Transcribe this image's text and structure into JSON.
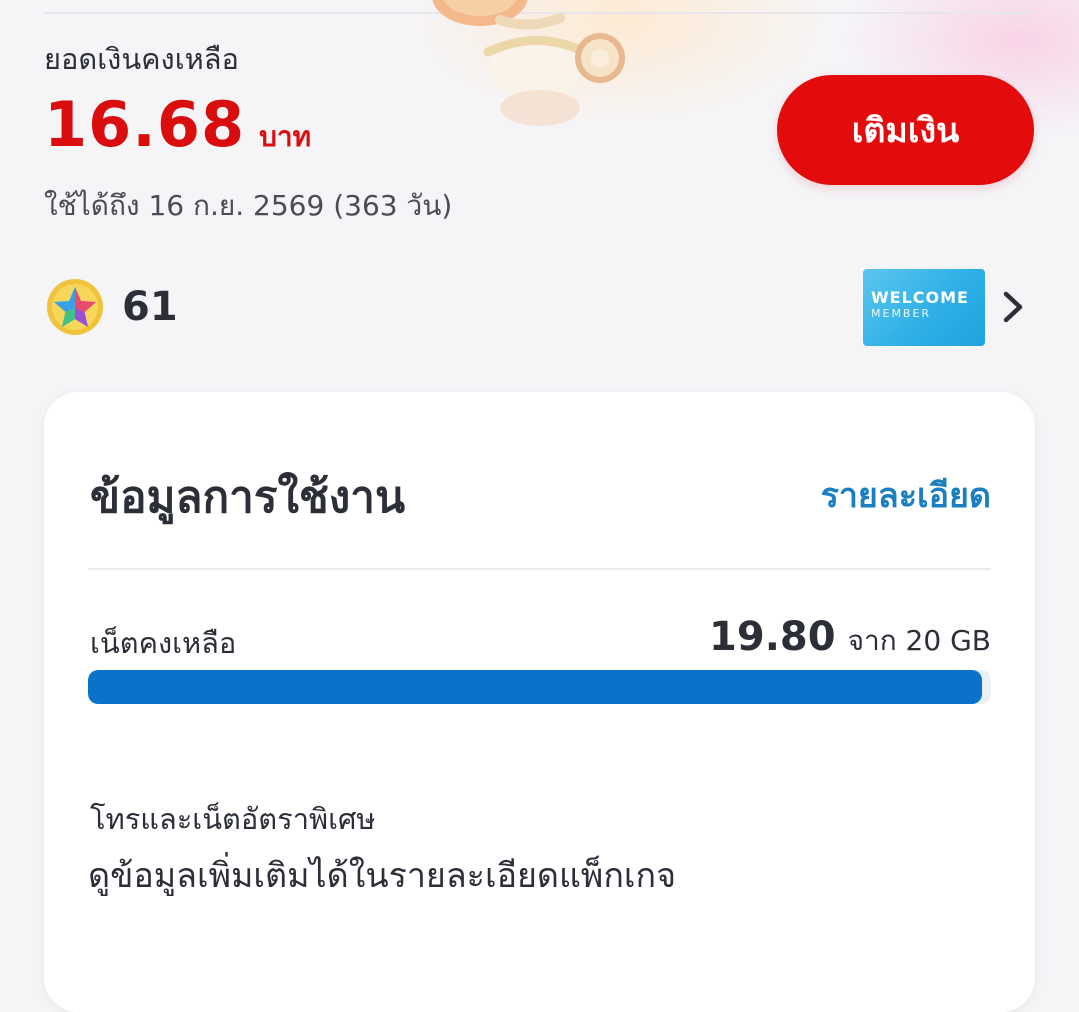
{
  "balance": {
    "label": "ยอดเงินคงเหลือ",
    "amount": "16.68",
    "unit": "บาท",
    "valid_until": "ใช้ได้ถึง 16 ก.ย. 2569 (363 วัน)",
    "topup_label": "เติมเงิน",
    "accent_color": "#e30b0b"
  },
  "points": {
    "icon": "star-coin-icon",
    "value": "61"
  },
  "member_card": {
    "line1": "WELCOME",
    "line2": "MEMBER",
    "icon": "chevron-right-icon"
  },
  "usage": {
    "title": "ข้อมูลการใช้งาน",
    "details_link": "รายละเอียด",
    "data_label": "เน็ตคงเหลือ",
    "data_remaining": "19.80",
    "data_total": "จาก 20 GB",
    "data_progress_fraction": 0.99,
    "progress_color": "#0a73c9",
    "special_label": "โทรและเน็ตอัตราพิเศษ",
    "special_desc": "ดูข้อมูลเพิ่มเติมได้ในรายละเอียดแพ็กเกจ"
  }
}
